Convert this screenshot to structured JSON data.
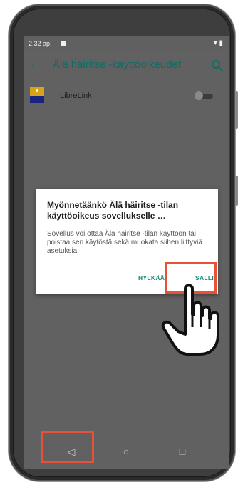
{
  "status_bar": {
    "time": "2.32 ap.",
    "indicators": "▾ ▮"
  },
  "toolbar": {
    "back_icon": "arrow-back-icon",
    "title": "Älä häiritse -käyttöoikeudet",
    "search_icon": "search-icon"
  },
  "list": {
    "items": [
      {
        "label": "LibreLink",
        "toggle_on": false
      }
    ]
  },
  "dialog": {
    "title": "Myönnetäänkö Älä häiritse -tilan käyttöoikeus sovellukselle …",
    "message": "Sovellus voi ottaa Älä häiritse -tilan käyttöön tai poistaa sen käytöstä sekä muokata siihen liittyviä asetuksia.",
    "deny_label": "HYLKÄÄ",
    "allow_label": "SALLI"
  },
  "nav_bar": {
    "back": "◁",
    "home": "○",
    "recents": "□"
  },
  "colors": {
    "accent": "#0e6d64",
    "highlight": "#e8503a",
    "scrim": "#616161"
  }
}
